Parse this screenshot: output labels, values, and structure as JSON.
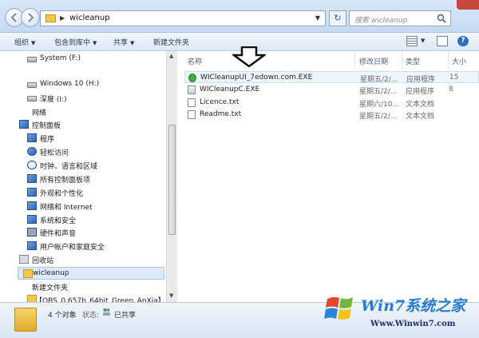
{
  "address": {
    "crumb": "wicleanup"
  },
  "search": {
    "placeholder": "搜索 wicleanup"
  },
  "toolbar": {
    "organize": "组织",
    "include": "包含到库中",
    "share": "共享",
    "new_folder": "新建文件夹"
  },
  "nav": {
    "items": [
      {
        "label": "System (F:)",
        "icon": "drive-icon"
      },
      {
        "label": "Windows 10 (H:)",
        "icon": "drive-icon"
      },
      {
        "label": "深度 (I:)",
        "icon": "drive-icon"
      },
      {
        "label": "网络",
        "icon": "network-icon"
      },
      {
        "label": "控制面板",
        "icon": "control-panel-icon"
      },
      {
        "label": "程序",
        "icon": "programs-icon"
      },
      {
        "label": "轻松访问",
        "icon": "accessibility-icon"
      },
      {
        "label": "时钟、语言和区域",
        "icon": "clock-icon"
      },
      {
        "label": "所有控制面板项",
        "icon": "control-panel-items-icon"
      },
      {
        "label": "外观和个性化",
        "icon": "appearance-icon"
      },
      {
        "label": "网络和 Internet",
        "icon": "network-internet-icon"
      },
      {
        "label": "系统和安全",
        "icon": "system-security-icon"
      },
      {
        "label": "硬件和声音",
        "icon": "hardware-sound-icon"
      },
      {
        "label": "用户帐户和家庭安全",
        "icon": "user-accounts-icon"
      },
      {
        "label": "回收站",
        "icon": "recycle-bin-icon"
      },
      {
        "label": "wicleanup",
        "icon": "folder-icon"
      },
      {
        "label": "新建文件夹",
        "icon": "folder-icon"
      },
      {
        "label": "【OBS_0.657b_64bit_Green_AnXia】",
        "icon": "folder-icon"
      }
    ]
  },
  "columns": {
    "name": "名称",
    "date": "修改日期",
    "type": "类型",
    "size": "大小"
  },
  "files": [
    {
      "name": "WICleanupUI_7edown.com.EXE",
      "date": "星期五/2/...",
      "type": "应用程序",
      "size": "15",
      "icon": "exe-green-icon"
    },
    {
      "name": "WICleanupC.EXE",
      "date": "星期五/2/...",
      "type": "应用程序",
      "size": "8",
      "icon": "exe-app-icon"
    },
    {
      "name": "Licence.txt",
      "date": "星期六/10...",
      "type": "文本文档",
      "size": "",
      "icon": "text-file-icon"
    },
    {
      "name": "Readme.txt",
      "date": "星期五/2/...",
      "type": "文本文档",
      "size": "",
      "icon": "text-file-icon"
    }
  ],
  "status": {
    "count": "4 个对象",
    "state_label": "状态:",
    "state_value": "已共享"
  },
  "watermark": {
    "brand": "Win7系统之家",
    "url": "Www.Winwin7.com"
  },
  "colors": {
    "accent": "#2a7bd0",
    "title_gradient_top": "#d9e8f8",
    "selection": "#dbe9f8"
  }
}
